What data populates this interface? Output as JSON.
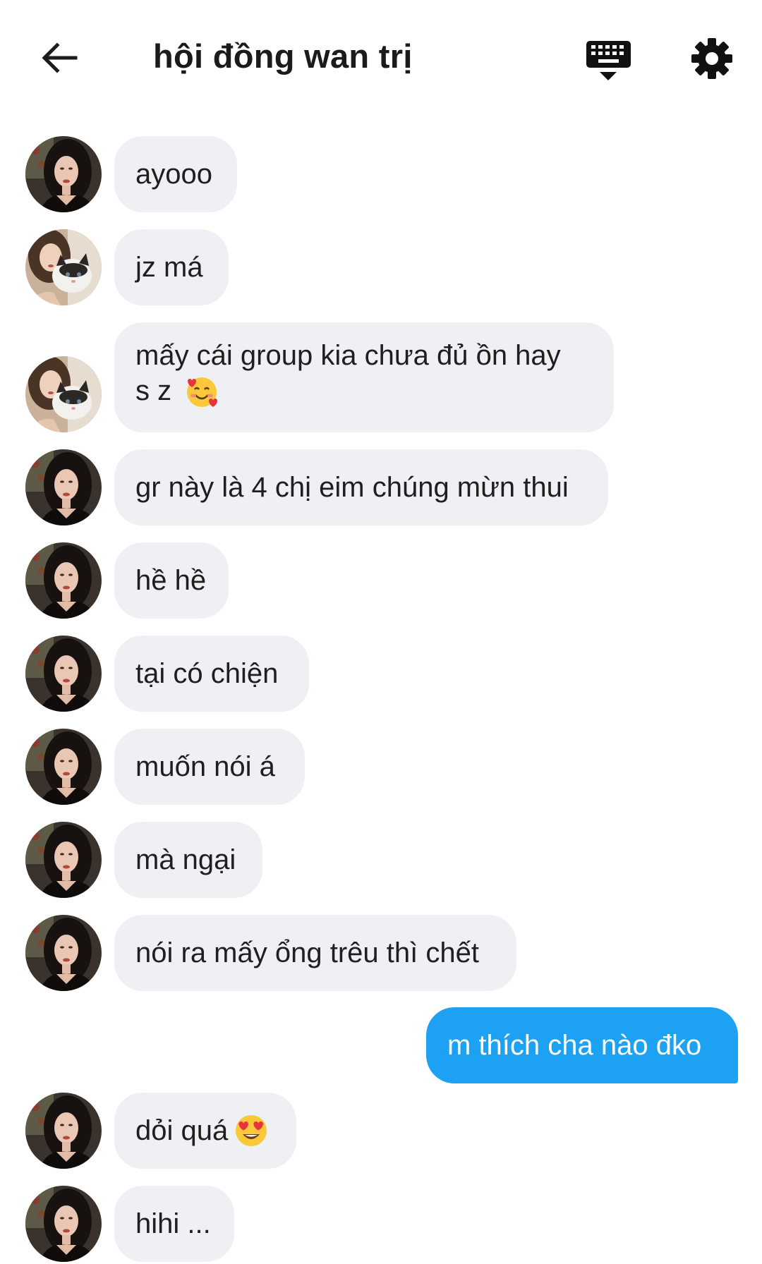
{
  "header": {
    "title": "hội đồng wan trị",
    "back_icon": "arrow-left-icon",
    "keyboard_icon": "keyboard-hide-icon",
    "settings_icon": "gear-icon"
  },
  "colors": {
    "incoming_bubble": "#eef0f3",
    "outgoing_bubble": "#1da1f2",
    "outgoing_text": "#ffffff",
    "incoming_text": "#1f1f1f"
  },
  "messages": [
    {
      "sender": "other",
      "avatar": "avatar-girl-dark-hair",
      "text": "ayooo"
    },
    {
      "sender": "other",
      "avatar": "avatar-girl-with-cat",
      "text": "jz má"
    },
    {
      "sender": "other",
      "avatar": "avatar-girl-with-cat",
      "text_line1": "mấy cái group kia chưa đủ ồn hay",
      "text_line2": "s z",
      "emoji": "smiling-face-with-hearts-emoji"
    },
    {
      "sender": "other",
      "avatar": "avatar-girl-dark-hair",
      "text": "gr này là 4 chị eim chúng mừn thui"
    },
    {
      "sender": "other",
      "avatar": "avatar-girl-dark-hair",
      "text": "hề hề"
    },
    {
      "sender": "other",
      "avatar": "avatar-girl-dark-hair",
      "text": "tại có chiện"
    },
    {
      "sender": "other",
      "avatar": "avatar-girl-dark-hair",
      "text": "muốn nói á"
    },
    {
      "sender": "other",
      "avatar": "avatar-girl-dark-hair",
      "text": "mà ngại"
    },
    {
      "sender": "other",
      "avatar": "avatar-girl-dark-hair",
      "text": "nói ra mấy ổng trêu thì chết"
    },
    {
      "sender": "me",
      "text": "m thích cha nào đko"
    },
    {
      "sender": "other",
      "avatar": "avatar-girl-dark-hair",
      "text": "dỏi quá",
      "emoji": "heart-eyes-emoji"
    },
    {
      "sender": "other",
      "avatar": "avatar-girl-dark-hair",
      "text": "hihi ..."
    }
  ]
}
